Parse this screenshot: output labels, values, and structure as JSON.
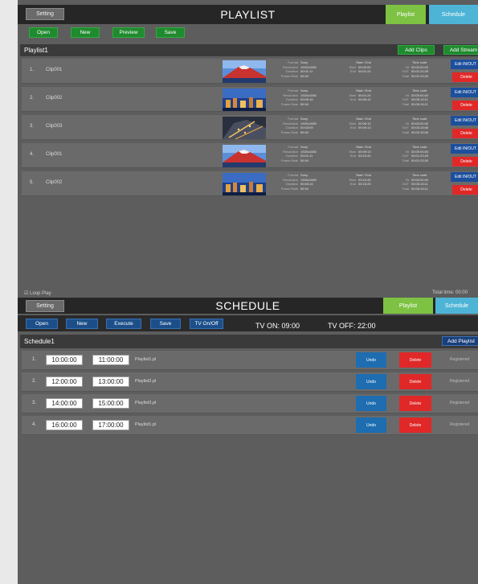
{
  "playlist": {
    "setting_label": "Setting",
    "title": "PLAYLIST",
    "tab_playlist": "Playlist",
    "tab_schedule": "Schedule",
    "toolbar": {
      "open": "Open",
      "new": "New",
      "preview": "Preview",
      "save": "Save"
    },
    "list_name": "Playlist1",
    "add_clips": "Add Clips",
    "add_stream": "Add Stream",
    "edit_label": "Edit IN/OUT",
    "delete_label": "Delete",
    "loop_play": "☑ Loop Play",
    "total_time": "Total time: 00:00",
    "meta_keys": {
      "format": "Format",
      "resolution": "Resolution",
      "duration": "Duration",
      "framerate": "Frame Rate",
      "start_end": "Start / End",
      "start": "Start",
      "end": "End",
      "timecode": "Time code",
      "in": "IN",
      "out": "OUT",
      "total": "Total"
    },
    "clips": [
      {
        "num": "1.",
        "name": "Clip001",
        "thumb": "mountain",
        "format": "Sony",
        "resolution": "1920x1080",
        "duration": "00:01:11",
        "framerate": "59.94",
        "start": "00:00:00",
        "end": "00:01:24",
        "in": "00:00:00:00",
        "out": "00:01:23:29",
        "total": "00:01:23:30"
      },
      {
        "num": "2.",
        "name": "Clip002",
        "thumb": "city",
        "format": "Sony",
        "resolution": "1920x1080",
        "duration": "00:05:16",
        "framerate": "59.94",
        "start": "00:01:24",
        "end": "00:06:10",
        "in": "00:00:00:00",
        "out": "00:05:15:11",
        "total": "00:05:15:11"
      },
      {
        "num": "3.",
        "name": "Clip003",
        "thumb": "aerial",
        "format": "Sony",
        "resolution": "1920x1080",
        "duration": "00:03:09",
        "framerate": "59.94",
        "start": "00:06:10",
        "end": "00:09:13",
        "in": "00:00:00:00",
        "out": "00:03:15:06",
        "total": "00:03:15:06"
      },
      {
        "num": "4.",
        "name": "Clip001",
        "thumb": "mountain",
        "format": "Sony",
        "resolution": "1920x1080",
        "duration": "00:01:11",
        "framerate": "59.94",
        "start": "00:09:13",
        "end": "00:10:40",
        "in": "00:00:00:00",
        "out": "00:01:23:29",
        "total": "00:01:23:30"
      },
      {
        "num": "5.",
        "name": "Clip002",
        "thumb": "city",
        "format": "Sony",
        "resolution": "1920x1080",
        "duration": "00:05:16",
        "framerate": "59.94",
        "start": "00:10:40",
        "end": "00:16:25",
        "in": "00:00:00:00",
        "out": "00:05:15:11",
        "total": "00:05:15:11"
      }
    ]
  },
  "schedule": {
    "setting_label": "Setting",
    "title": "SCHEDULE",
    "tab_playlist": "Playlist",
    "tab_schedule": "Schedule",
    "toolbar": {
      "open": "Open",
      "new": "New",
      "execute": "Execute",
      "save": "Save",
      "tv_onoff": "TV On/Off"
    },
    "tv_on": "TV ON: 09:00",
    "tv_off": "TV OFF: 22:00",
    "list_name": "Schedule1",
    "add_playlist": "Add Playlist",
    "rows": [
      {
        "num": "1.",
        "start": "10:00:00",
        "end": "11:00:00",
        "playlist": "Playlist1.pl",
        "edit": "Undo",
        "delete": "Delete",
        "status": "Registered"
      },
      {
        "num": "2.",
        "start": "12:00:00",
        "end": "13:00:00",
        "playlist": "Playlist2.pl",
        "edit": "Undo",
        "delete": "Delete",
        "status": "Registered"
      },
      {
        "num": "3.",
        "start": "14:00:00",
        "end": "15:00:00",
        "playlist": "Playlist3.pl",
        "edit": "Undo",
        "delete": "Delete",
        "status": "Registered"
      },
      {
        "num": "4.",
        "start": "16:00:00",
        "end": "17:00:00",
        "playlist": "Playlist1.pl",
        "edit": "Undo",
        "delete": "Delete",
        "status": "Registered"
      }
    ]
  },
  "colors": {
    "green": "#1f8a2e",
    "blue": "#1c4f8a",
    "red": "#e02828",
    "tab_playlist": "#7dc242",
    "tab_schedule": "#4db4d6"
  }
}
